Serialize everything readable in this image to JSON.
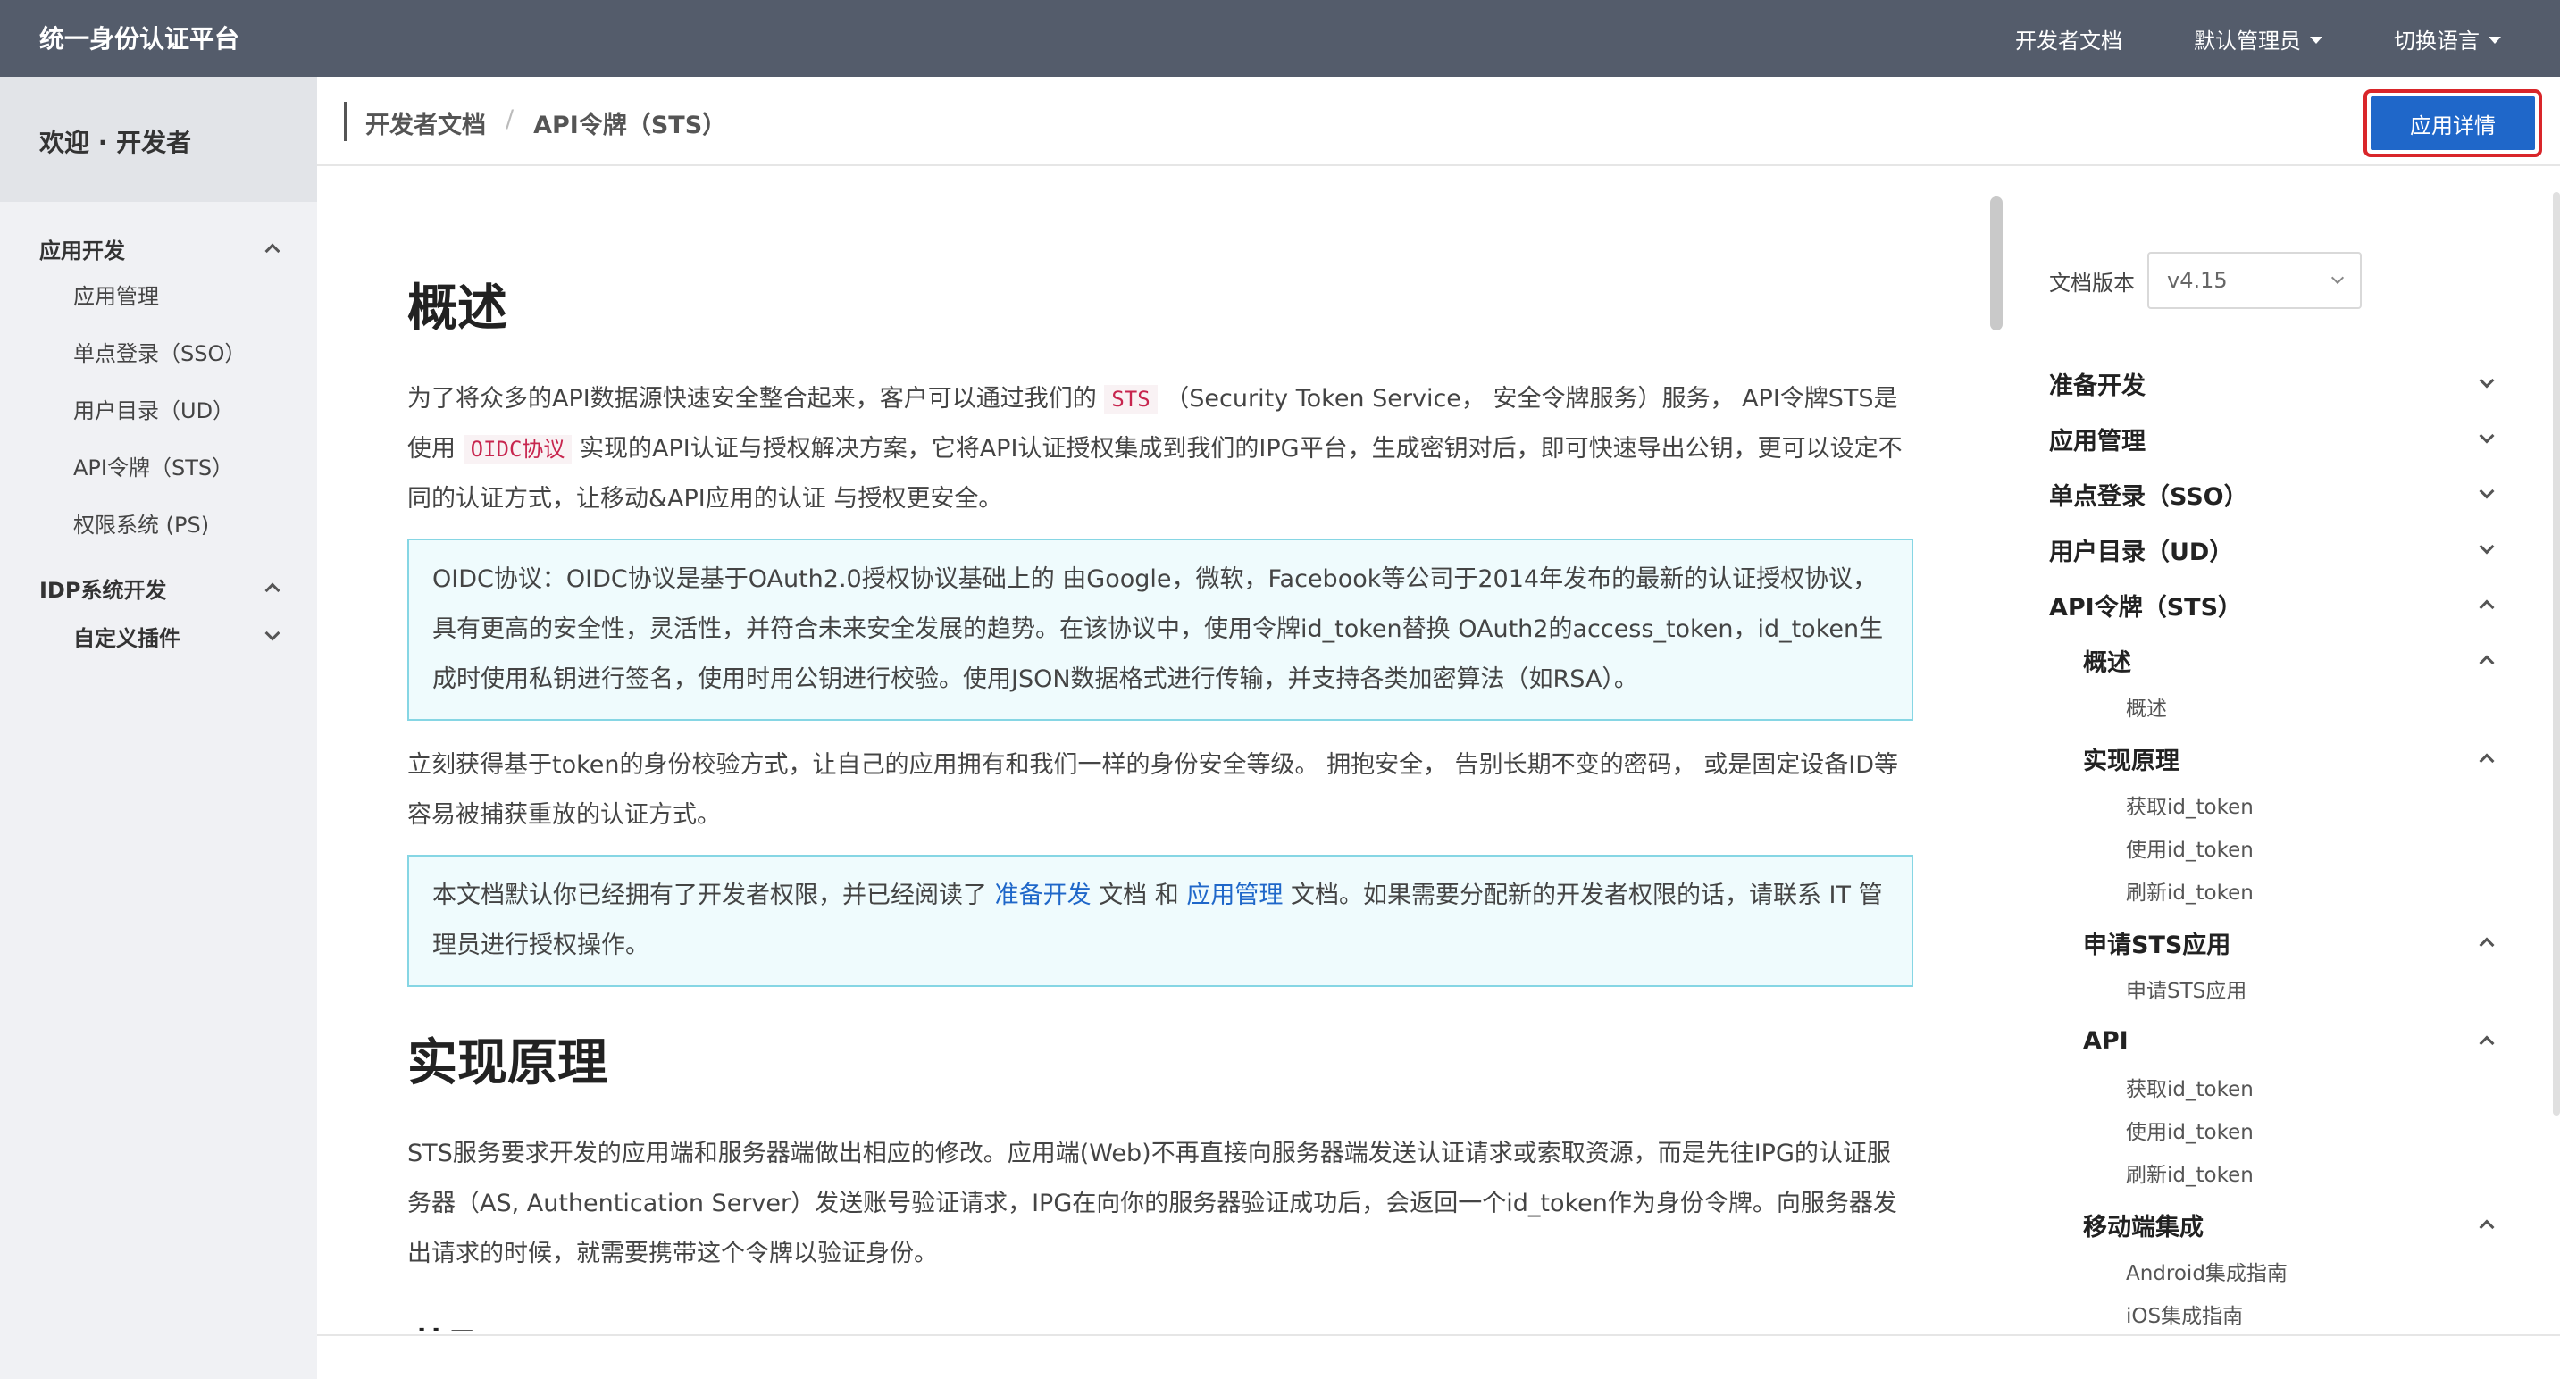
{
  "app": {
    "title": "统一身份认证平台"
  },
  "topnav": {
    "docs": "开发者文档",
    "admin": "默认管理员",
    "lang": "切换语言"
  },
  "sidebar": {
    "welcome": "欢迎 · 开发者",
    "groups": [
      {
        "label": "应用开发",
        "items": [
          "应用管理",
          "单点登录（SSO）",
          "用户目录（UD）",
          "API令牌（STS）",
          "权限系统 (PS)"
        ]
      },
      {
        "label": "IDP系统开发",
        "subgroup": "自定义插件"
      }
    ]
  },
  "breadcrumb": {
    "root": "开发者文档",
    "sep": "/",
    "current": "API令牌（STS）"
  },
  "header": {
    "detail_button": "应用详情"
  },
  "content": {
    "h1_overview": "概述",
    "p1_a": "为了将众多的API数据源快速安全整合起来，客户可以通过我们的",
    "p1_code1": "STS",
    "p1_b": "（Security Token Service， 安全令牌服务）服务， API令牌STS是使用",
    "p1_code2": "OIDC协议",
    "p1_c": "实现的API认证与授权解决方案，它将API认证授权集成到我们的IPG平台，生成密钥对后，即可快速导出公钥，更可以设定不同的认证方式，让移动&API应用的认证 与授权更安全。",
    "notice1": "OIDC协议：OIDC协议是基于OAuth2.0授权协议基础上的 由Google，微软，Facebook等公司于2014年发布的最新的认证授权协议，具有更高的安全性，灵活性，并符合未来安全发展的趋势。在该协议中，使用令牌id_token替换 OAuth2的access_token，id_token生成时使用私钥进行签名，使用时用公钥进行校验。使用JSON数据格式进行传输，并支持各类加密算法（如RSA）。",
    "p2": "立刻获得基于token的身份校验方式，让自己的应用拥有和我们一样的身份安全等级。 拥抱安全， 告别长期不变的密码， 或是固定设备ID等容易被捕获重放的认证方式。",
    "notice2_a": "本文档默认你已经拥有了开发者权限，并已经阅读了",
    "notice2_link1": "准备开发",
    "notice2_b": "文档 和",
    "notice2_link2": "应用管理",
    "notice2_c": "文档。如果需要分配新的开发者权限的话，请联系 IT 管理员进行授权操作。",
    "h1_principle": "实现原理",
    "p3": "STS服务要求开发的应用端和服务器端做出相应的修改。应用端(Web)不再直接向服务器端发送认证请求或索取资源，而是先往IPG的认证服务器（AS, Authentication Server）发送账号验证请求，IPG在向你的服务器验证成功后，会返回一个id_token作为身份令牌。向服务器发出请求的时候，就需要携带这个令牌以验证身份。",
    "h2_get": "获取 id_token"
  },
  "toc": {
    "version_label": "文档版本",
    "version_value": "v4.15",
    "top": [
      "准备开发",
      "应用管理",
      "单点登录（SSO）",
      "用户目录（UD）",
      "API令牌（STS）"
    ],
    "sections": [
      {
        "label": "概述",
        "items": [
          "概述"
        ]
      },
      {
        "label": "实现原理",
        "items": [
          "获取id_token",
          "使用id_token",
          "刷新id_token"
        ]
      },
      {
        "label": "申请STS应用",
        "items": [
          "申请STS应用"
        ]
      },
      {
        "label": "API",
        "items": [
          "获取id_token",
          "使用id_token",
          "刷新id_token"
        ]
      },
      {
        "label": "移动端集成",
        "items": [
          "Android集成指南",
          "iOS集成指南"
        ]
      }
    ]
  },
  "colors": {
    "topbar": "#545c6b",
    "primary": "#1f67c9",
    "highlight": "#d9262a",
    "notice_border": "#86d6e4"
  }
}
